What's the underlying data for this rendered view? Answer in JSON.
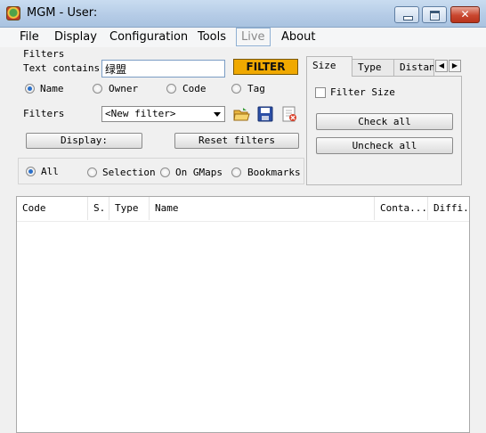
{
  "window": {
    "title": "MGM - User:"
  },
  "menu": [
    {
      "label": "File",
      "enabled": true
    },
    {
      "label": "Display",
      "enabled": true
    },
    {
      "label": "Configuration",
      "enabled": true
    },
    {
      "label": "Tools",
      "enabled": true
    },
    {
      "label": "Live",
      "enabled": false
    },
    {
      "label": "About",
      "enabled": true
    }
  ],
  "filters": {
    "group_label": "Filters",
    "text_contains_label": "Text contains",
    "text_value": "绿盟",
    "filter_button": "FILTER",
    "search_fields": [
      {
        "label": "Name",
        "selected": true
      },
      {
        "label": "Owner",
        "selected": false
      },
      {
        "label": "Code",
        "selected": false
      },
      {
        "label": "Tag",
        "selected": false
      }
    ],
    "filters_label": "Filters",
    "filter_select_value": "<New filter>",
    "display_button": "Display:",
    "reset_button": "Reset filters",
    "scope": [
      {
        "label": "All",
        "selected": true
      },
      {
        "label": "Selection",
        "selected": false
      },
      {
        "label": "On GMaps",
        "selected": false
      },
      {
        "label": "Bookmarks",
        "selected": false
      }
    ]
  },
  "tabs": {
    "items": [
      "Size",
      "Type",
      "Distanc"
    ],
    "active": "Size",
    "filter_size_label": "Filter Size",
    "filter_size_checked": false,
    "check_all": "Check all",
    "uncheck_all": "Uncheck all"
  },
  "list": {
    "columns": [
      "Code",
      "S.",
      "Type",
      "Name",
      "Conta...",
      "Diffi..."
    ],
    "rows": []
  },
  "colors": {
    "filter_button": "#f0a900",
    "accent": "#2a6fc9"
  }
}
